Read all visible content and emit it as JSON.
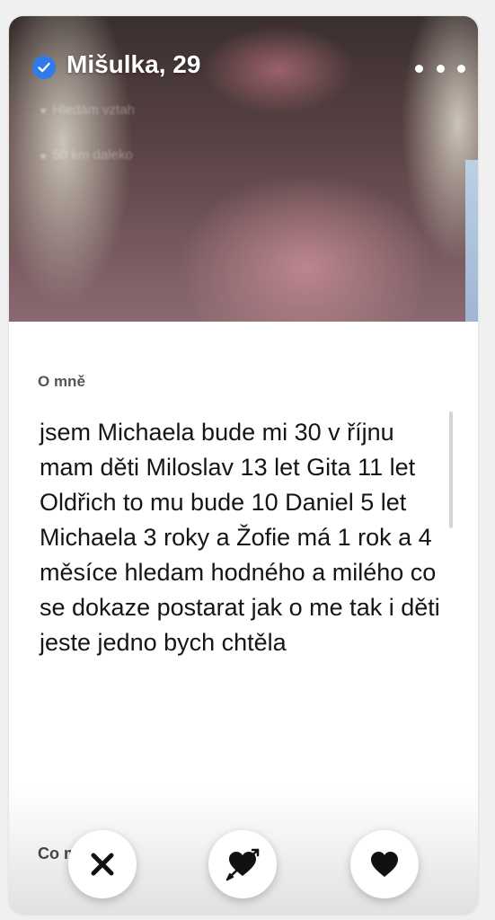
{
  "profile": {
    "name": "Mišulka, 29",
    "verified": true,
    "looking_for": "Hledám vztah",
    "distance": "50 km daleko"
  },
  "about": {
    "label": "O mně",
    "text": "jsem Michaela bude mi 30 v říjnu mam děti Miloslav 13 let Gita 11 let Oldřich to mu bude 10 Daniel 5 let Michaela 3 roky a Žofie má 1 rok a 4 měsíce hledam hodného a milého co se dokaze postarat jak o me tak i děti jeste jedno bych chtěla"
  },
  "next_section": {
    "label": "Co         m"
  },
  "actions": {
    "pass_icon": "x-icon",
    "super_like_icon": "heart-arrow-icon",
    "like_icon": "heart-icon"
  },
  "colors": {
    "verified_badge": "#2f7bea",
    "text_primary": "#151515",
    "icon_dark": "#111111"
  }
}
